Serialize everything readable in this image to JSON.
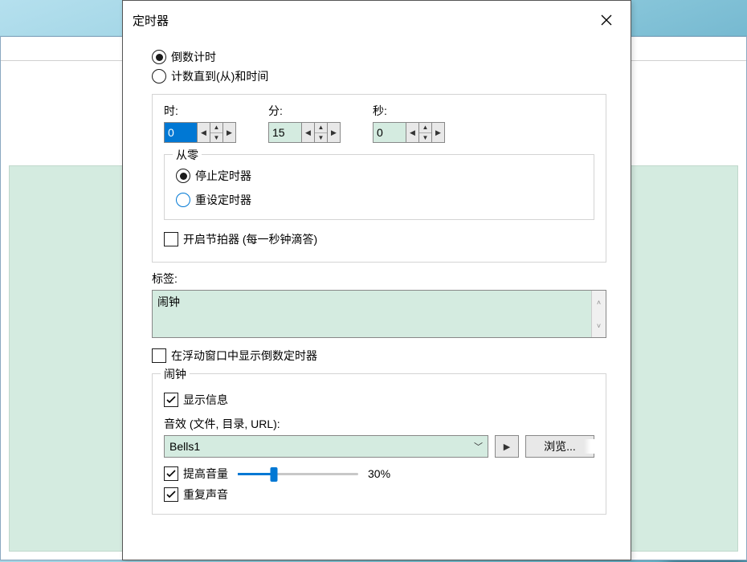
{
  "dialog": {
    "title": "定时器",
    "mode": {
      "countdown": "倒数计时",
      "countto": "计数直到(从)和时间"
    },
    "time": {
      "hour_label": "时:",
      "hour_value": "0",
      "min_label": "分:",
      "min_value": "15",
      "sec_label": "秒:",
      "sec_value": "0"
    },
    "from_zero": {
      "legend": "从零",
      "stop": "停止定时器",
      "reset": "重设定时器"
    },
    "metronome": "开启节拍器 (每一秒钟滴答)",
    "label_section": {
      "title": "标签:",
      "value": "闹钟"
    },
    "show_in_float": "在浮动窗口中显示倒数定时器",
    "alarm": {
      "legend": "闹钟",
      "show_info": "显示信息",
      "sound_label": "音效 (文件, 目录, URL):",
      "sound_value": "Bells1",
      "browse": "浏览...",
      "boost_volume": "提高音量",
      "volume_pct": "30%",
      "volume_value": 30,
      "repeat_sound": "重复声音"
    }
  }
}
